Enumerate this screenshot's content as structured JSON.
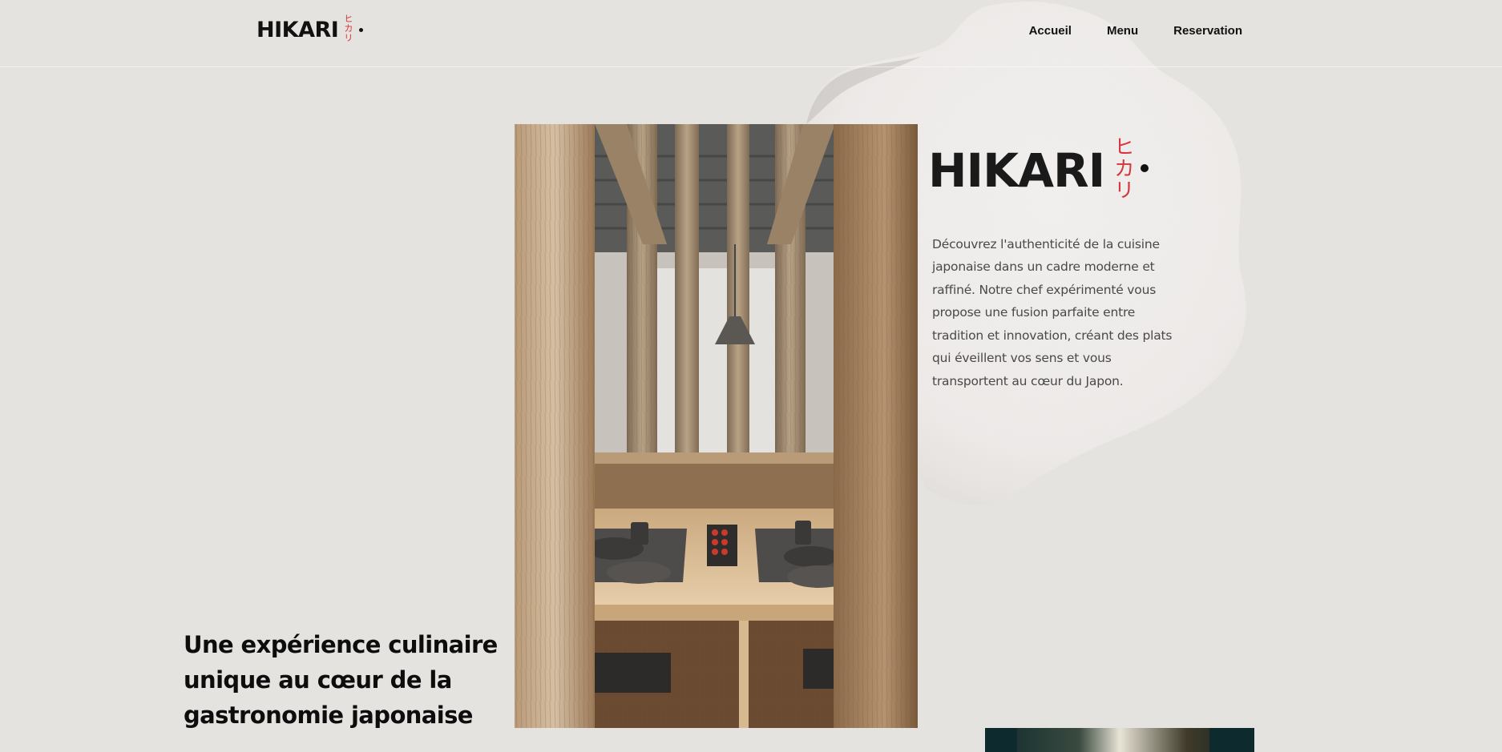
{
  "brand": {
    "wordmark": "HIKARI",
    "kana": [
      "ヒ",
      "カ",
      "リ"
    ]
  },
  "nav": {
    "items": [
      {
        "label": "Accueil"
      },
      {
        "label": "Menu"
      },
      {
        "label": "Reservation"
      }
    ]
  },
  "hero": {
    "intro": "Découvrez l'authenticité de la cuisine japonaise dans un cadre moderne et raffiné. Notre chef expérimenté vous propose une fusion parfaite entre tradition et innovation, créant des plats qui éveillent vos sens et vous transportent au cœur du Japon.",
    "headline": "Une expérience culinaire unique au cœur de la gastronomie japonaise"
  },
  "colors": {
    "background": "#e5e3df",
    "accent_red": "#d8333a",
    "ink": "#111111"
  }
}
